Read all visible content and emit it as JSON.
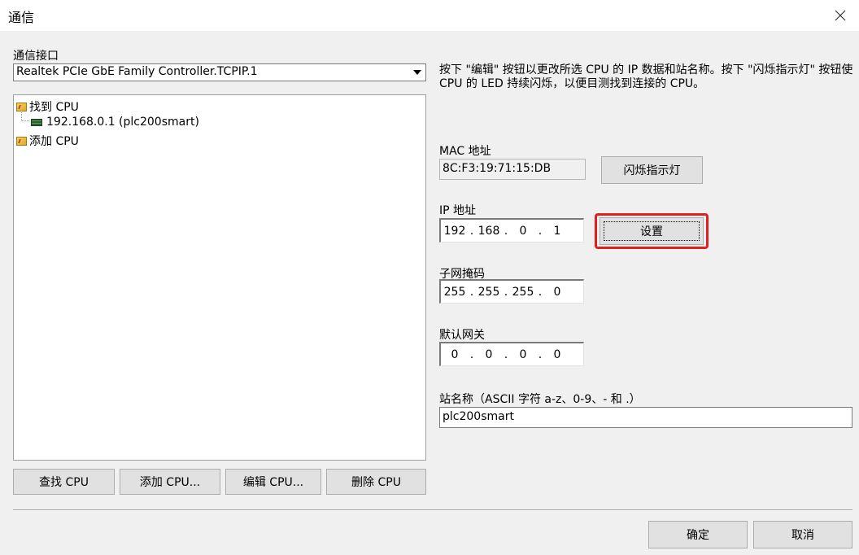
{
  "window": {
    "title": "通信",
    "close_icon": "close-icon"
  },
  "interface": {
    "label": "通信接口",
    "selected": "Realtek PCIe GbE Family Controller.TCPIP.1"
  },
  "tree": {
    "found_label": "找到 CPU",
    "device_label": "192.168.0.1 (plc200smart)",
    "add_label": "添加 CPU"
  },
  "description": "按下 \"编辑\" 按钮以更改所选 CPU 的 IP 数据和站名称。按下 \"闪烁指示灯\" 按钮使 CPU 的 LED 持续闪烁，以便目测找到连接的 CPU。",
  "mac": {
    "label": "MAC 地址",
    "value": "8C:F3:19:71:15:DB",
    "blink_button": "闪烁指示灯"
  },
  "ip": {
    "label": "IP 地址",
    "octets": [
      "192",
      "168",
      "0",
      "1"
    ],
    "set_button": "设置"
  },
  "subnet": {
    "label": "子网掩码",
    "octets": [
      "255",
      "255",
      "255",
      "0"
    ]
  },
  "gateway": {
    "label": "默认网关",
    "octets": [
      "0",
      "0",
      "0",
      "0"
    ]
  },
  "station": {
    "label": "站名称（ASCII 字符 a-z、0-9、- 和 .）",
    "value": "plc200smart"
  },
  "buttons": {
    "find": "查找 CPU",
    "add": "添加 CPU...",
    "edit": "编辑 CPU...",
    "delete": "删除 CPU",
    "ok": "确定",
    "cancel": "取消"
  },
  "colors": {
    "highlight": "#e02020",
    "window_bg": "#f0f0f0"
  }
}
